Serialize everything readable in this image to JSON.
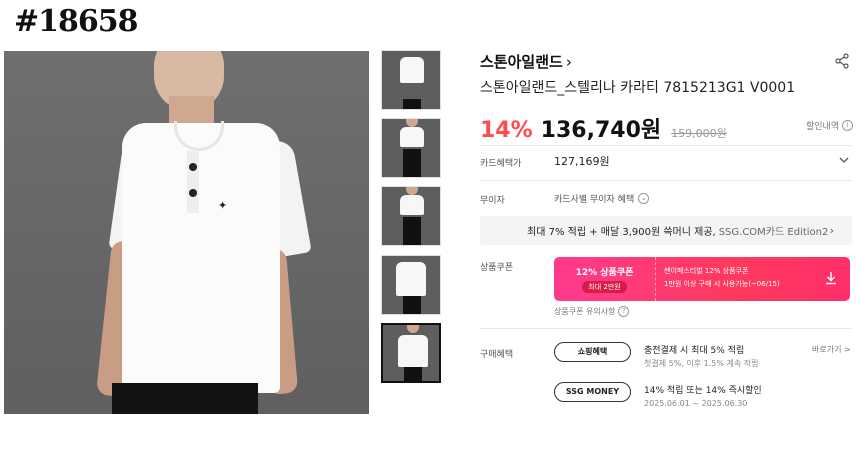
{
  "post_id": "#18658",
  "product": {
    "brand": "스톤아일랜드",
    "title": "스톤아일랜드_스텔리나 카라티 7815213G1 V0001",
    "discount": "14%",
    "price": "136,740원",
    "original_price": "159,000원",
    "discount_history": "할인내역"
  },
  "rows": {
    "card_benefit_label": "카드혜택가",
    "card_benefit_value": "127,169원",
    "interest_free_label": "무이자",
    "interest_free_value": "카드사별 무이자 혜택",
    "promo_main": "최대 7% 적립 + 매달 3,900원 쓱머니 제공,",
    "promo_sub": "SSG.COM카드 Edition2",
    "coupon_label": "상품쿠폰",
    "purchase_label": "구매혜택"
  },
  "coupon": {
    "title": "12% 상품쿠폰",
    "max": "최대 2만원",
    "line1": "쌘이페스티벌 12% 상품쿠폰",
    "line2": "1만원 이상 구매 시 사용가능(~06/15)",
    "note": "상품쿠폰 유의사항"
  },
  "benefits": [
    {
      "pill": "쇼핑혜택",
      "line1": "충전결제 시 최대 5% 적립",
      "line2": "첫결제 5%, 이후 1.5% 계속 적립"
    },
    {
      "pill": "SSG MONEY",
      "line1": "14% 적립 또는 14% 즉시할인",
      "line2": "2025.06.01 ~ 2025.06.30"
    }
  ],
  "view_more": "바로가기 >",
  "colors": {
    "discount": "#ff4d4f",
    "coupon_gradient_start": "#ff3a8f",
    "coupon_gradient_end": "#ff2f6a"
  }
}
